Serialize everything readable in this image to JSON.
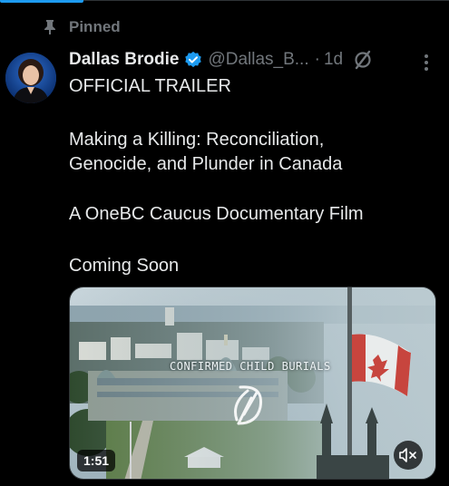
{
  "pinned": {
    "label": "Pinned"
  },
  "post": {
    "author_name": "Dallas Brodie",
    "handle": "@Dallas_B...",
    "separator": "·",
    "time": "1d",
    "lines": [
      "OFFICIAL TRAILER",
      "Making a Killing: Reconciliation,",
      "Genocide, and Plunder in Canada",
      "A OneBC Caucus Documentary Film",
      "Coming Soon"
    ]
  },
  "video": {
    "overlay_caption": "CONFIRMED CHILD BURIALS",
    "duration": "1:51"
  },
  "icons": {
    "pin": "pin-icon",
    "verified": "verified-badge-icon",
    "grok": "grok-icon",
    "more": "more-options-icon",
    "mute": "muted-speaker-icon"
  },
  "colors": {
    "background": "#000000",
    "text": "#e7e9ea",
    "secondary": "#71767b",
    "accent": "#1d9bf0"
  }
}
